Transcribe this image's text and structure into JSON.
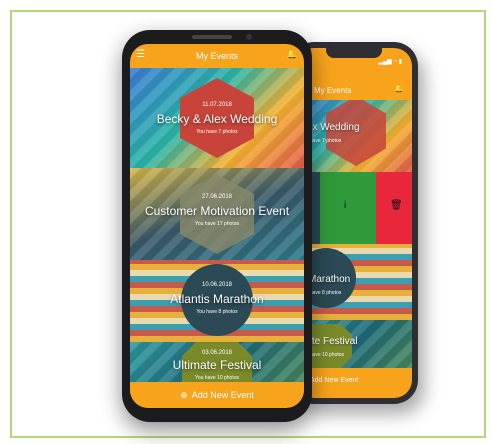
{
  "app": {
    "title": "My Events",
    "menu_icon": "menu-icon",
    "bell_icon": "bell-icon",
    "add_button": "Add New Event",
    "colors": {
      "accent": "#f7a31c",
      "frame": "#b6d57a",
      "green": "#2e9a3a",
      "red": "#e8283a"
    }
  },
  "events": [
    {
      "date": "11.07.2018",
      "title": "Becky & Alex Wedding",
      "subtitle": "You have 7 photos"
    },
    {
      "date": "27.06.2018",
      "title": "Customer Motivation Event",
      "subtitle": "You have 17 photos"
    },
    {
      "date": "10.06.2018",
      "title": "Atlantis Marathon",
      "subtitle": "You have 8 photos"
    },
    {
      "date": "03.06.2018",
      "title": "Ultimate Festival",
      "subtitle": "You have 10 photos"
    }
  ],
  "back_phone": {
    "title": "My Events",
    "status": "▂▄▆ ◔ ▮",
    "cards": [
      {
        "title": "Alex Wedding",
        "subtitle": "You have 7 photos"
      },
      {
        "title": "is Marathon",
        "subtitle": "You have 8 photos"
      },
      {
        "title": "mate Festival",
        "subtitle": "You have 10 photos"
      }
    ],
    "swipe_actions": {
      "info_icon": "info-icon",
      "delete_icon": "trash-icon",
      "info_glyph": "i",
      "delete_glyph": "🗑"
    },
    "add_button": "Add New Event"
  }
}
